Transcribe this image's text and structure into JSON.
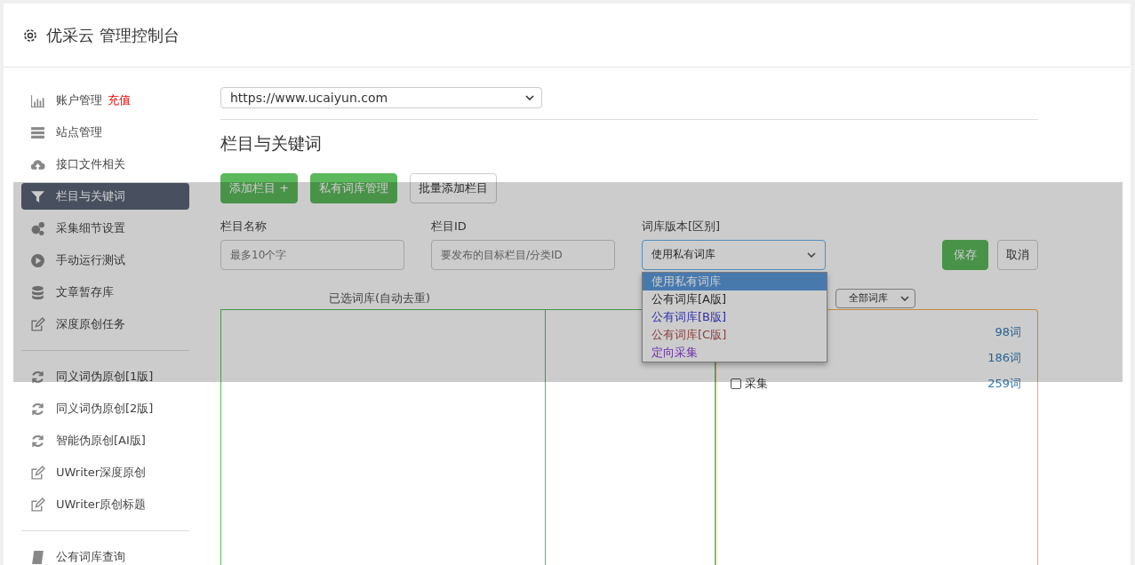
{
  "header": {
    "title": "优采云 管理控制台"
  },
  "sidebar": {
    "groups": [
      [
        {
          "label": "账户管理",
          "badge": "充值",
          "selected": false
        },
        {
          "label": "站点管理",
          "selected": false
        },
        {
          "label": "接口文件相关",
          "selected": false
        },
        {
          "label": "栏目与关键词",
          "selected": true
        },
        {
          "label": "采集细节设置",
          "selected": false
        },
        {
          "label": "手动运行测试",
          "selected": false
        },
        {
          "label": "文章暂存库",
          "selected": false
        },
        {
          "label": "深度原创任务",
          "selected": false
        }
      ],
      [
        {
          "label": "同义词伪原创[1版]",
          "selected": false
        },
        {
          "label": "同义词伪原创[2版]",
          "selected": false
        },
        {
          "label": "智能伪原创[AI版]",
          "selected": false
        },
        {
          "label": "UWriter深度原创",
          "selected": false
        },
        {
          "label": "UWriter原创标题",
          "selected": false
        }
      ],
      [
        {
          "label": "公有词库查询",
          "selected": false
        }
      ]
    ]
  },
  "site_select": {
    "value": "https://www.ucaiyun.com"
  },
  "section_title": "栏目与关键词",
  "buttons": [
    {
      "label": "添加栏目 +",
      "kind": "primary"
    },
    {
      "label": "私有词库管理",
      "kind": "primary"
    },
    {
      "label": "批量添加栏目",
      "kind": "plain"
    }
  ],
  "form": {
    "name_label": "栏目名称",
    "name_placeholder": "最多10个字",
    "id_label": "栏目ID",
    "id_placeholder": "要发布的目标栏目/分类ID",
    "version_label": "词库版本[区别]",
    "version_value": "使用私有词库",
    "version_options": [
      {
        "label": "使用私有词库",
        "selected": true
      },
      {
        "label": "公有词库[A版]",
        "selected": false
      },
      {
        "label": "公有词库[B版]",
        "selected": false
      },
      {
        "label": "公有词库[C版]",
        "selected": false
      },
      {
        "label": "定向采集",
        "selected": false
      }
    ],
    "save": "保存",
    "cancel": "取消"
  },
  "selected_label": "已选词库(自动去重)",
  "filter_select": {
    "value": "全部词库"
  },
  "library_rows": [
    {
      "count": "98词"
    },
    {
      "count": "186词"
    },
    {
      "label": "采集",
      "checked": false,
      "count": "259词"
    }
  ]
}
